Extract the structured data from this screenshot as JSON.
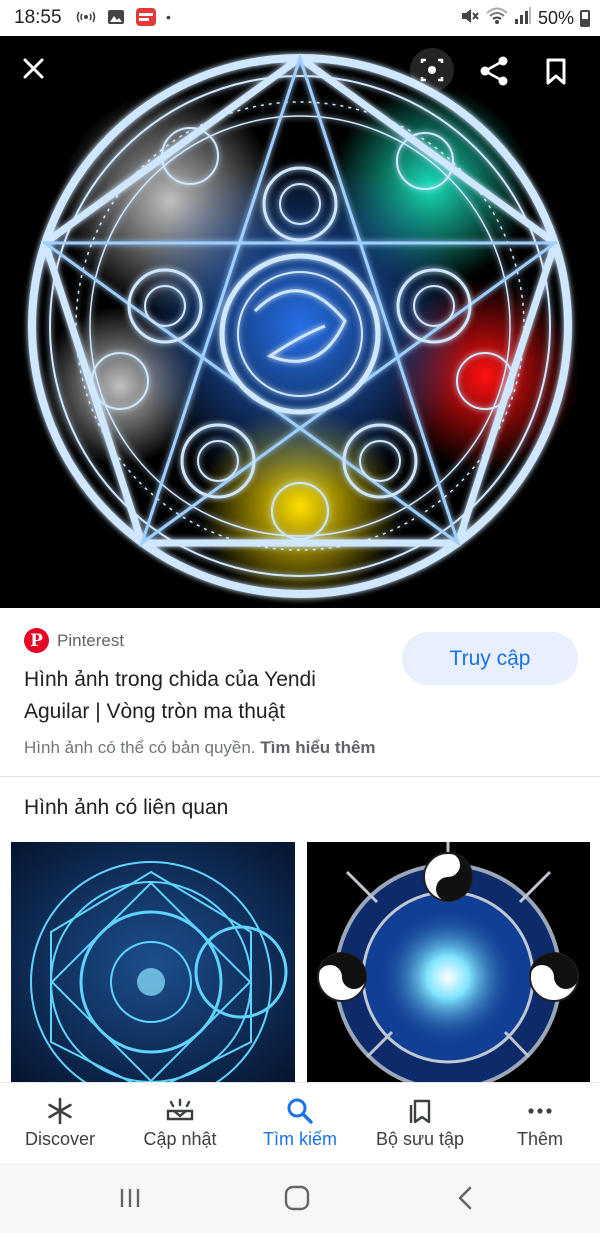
{
  "status_bar": {
    "time": "18:55",
    "battery": "50%",
    "icons_left": [
      "wifi-calling-icon",
      "gallery-icon",
      "mangatoon-icon",
      "dot-icon"
    ],
    "icons_right": [
      "mute-icon",
      "wifi-icon",
      "signal-icon",
      "battery-icon"
    ]
  },
  "hero": {
    "image_semantic": "magic-circle-pentagram-image",
    "actions": [
      "close-icon",
      "lens-icon",
      "share-icon",
      "bookmark-icon"
    ]
  },
  "source": {
    "site_name": "Pinterest",
    "title": "Hình ảnh trong chida của Yendi Aguilar | Vòng tròn ma thuật",
    "visit_label": "Truy cập",
    "copyright_text": "Hình ảnh có thể có bản quyền.",
    "learn_more_label": "Tìm hiểu thêm",
    "brand_color": "#e60023"
  },
  "related": {
    "heading": "Hình ảnh có liên quan",
    "thumbnails": [
      "blue-magic-circle-image",
      "yin-yang-magic-circle-image"
    ]
  },
  "bottom_nav": {
    "items": [
      {
        "label": "Discover",
        "icon": "asterisk-icon"
      },
      {
        "label": "Cập nhật",
        "icon": "updates-icon"
      },
      {
        "label": "Tìm kiếm",
        "icon": "search-icon"
      },
      {
        "label": "Bộ sưu tập",
        "icon": "collections-icon"
      },
      {
        "label": "Thêm",
        "icon": "more-icon"
      }
    ],
    "active_index": 2,
    "active_color": "#1a73e8"
  },
  "system_nav": [
    "recents-icon",
    "home-icon",
    "back-icon"
  ]
}
